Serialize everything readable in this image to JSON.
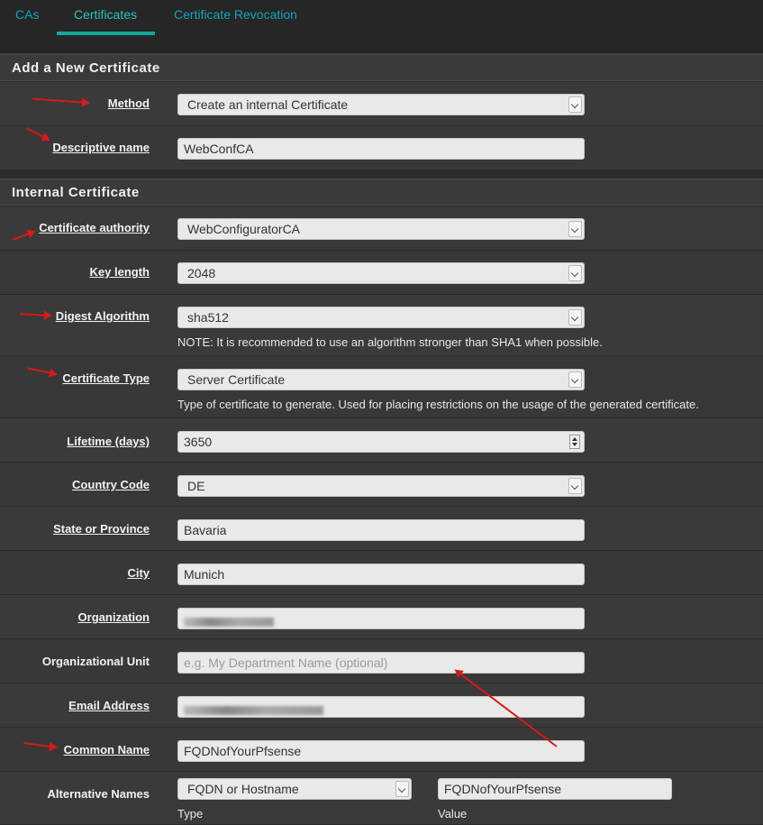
{
  "tabs": [
    {
      "label": "CAs"
    },
    {
      "label": "Certificates"
    },
    {
      "label": "Certificate Revocation"
    }
  ],
  "sections": {
    "new_cert": "Add a New Certificate",
    "internal_cert": "Internal Certificate"
  },
  "fields": {
    "method": {
      "label": "Method",
      "value": "Create an internal Certificate"
    },
    "descr": {
      "label": "Descriptive name",
      "value": "WebConfCA"
    },
    "ca": {
      "label": "Certificate authority",
      "value": "WebConfiguratorCA"
    },
    "keylen": {
      "label": "Key length",
      "value": "2048"
    },
    "digest": {
      "label": "Digest Algorithm",
      "value": "sha512",
      "help": "NOTE: It is recommended to use an algorithm stronger than SHA1 when possible."
    },
    "type": {
      "label": "Certificate Type",
      "value": "Server Certificate",
      "help": "Type of certificate to generate. Used for placing restrictions on the usage of the generated certificate."
    },
    "lifetime": {
      "label": "Lifetime (days)",
      "value": "3650"
    },
    "country": {
      "label": "Country Code",
      "value": "DE"
    },
    "state": {
      "label": "State or Province",
      "value": "Bavaria"
    },
    "city": {
      "label": "City",
      "value": "Munich"
    },
    "org": {
      "label": "Organization",
      "value": ""
    },
    "orgunit": {
      "label": "Organizational Unit",
      "placeholder": "e.g. My Department Name (optional)"
    },
    "email": {
      "label": "Email Address",
      "value": ""
    },
    "cn": {
      "label": "Common Name",
      "value": "FQDNofYourPfsense"
    },
    "altnames": {
      "label": "Alternative Names",
      "type_value": "FQDN or Hostname",
      "value": "FQDNofYourPfsense",
      "type_caption": "Type",
      "value_caption": "Value"
    }
  },
  "colors": {
    "accent": "#13a89e",
    "link": "#17a2b8",
    "arrow": "#d61a1a"
  }
}
